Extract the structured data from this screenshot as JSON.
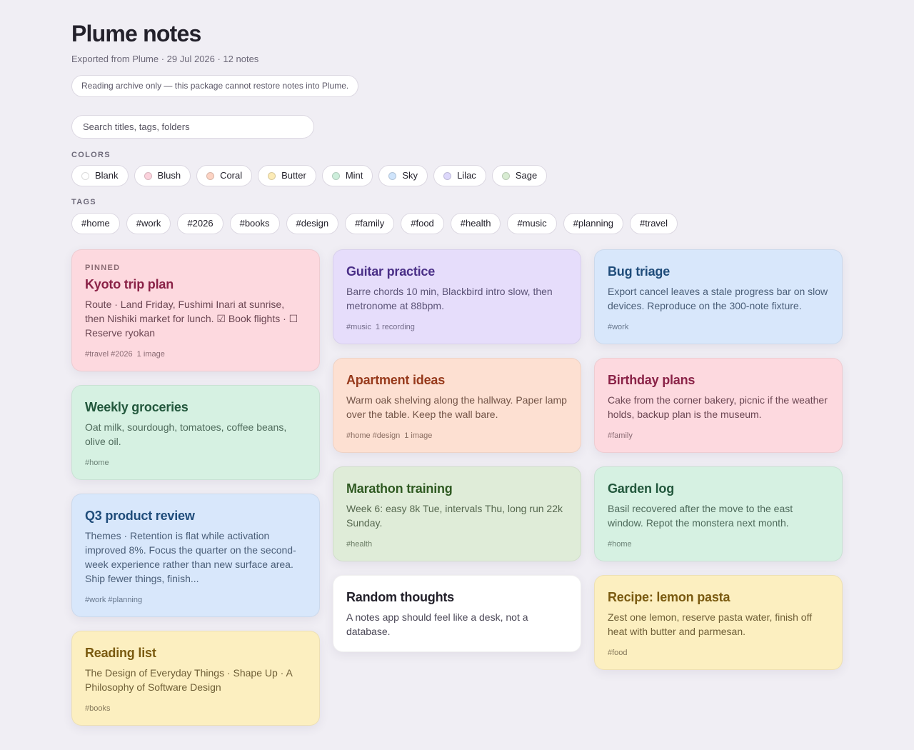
{
  "header": {
    "title": "Plume notes",
    "subtitle": "Exported from Plume · 29 Jul 2026 · 12 notes",
    "notice": "Reading archive only — this package cannot restore notes into Plume."
  },
  "search": {
    "placeholder": "Search titles, tags, folders"
  },
  "colors": {
    "label": "COLORS",
    "items": [
      {
        "label": "Blank",
        "swatch": "#ffffff"
      },
      {
        "label": "Blush",
        "swatch": "#fbd2dc"
      },
      {
        "label": "Coral",
        "swatch": "#fcd3c3"
      },
      {
        "label": "Butter",
        "swatch": "#fcebb6"
      },
      {
        "label": "Mint",
        "swatch": "#cdeedb"
      },
      {
        "label": "Sky",
        "swatch": "#cfe4fb"
      },
      {
        "label": "Lilac",
        "swatch": "#ddd8fb"
      },
      {
        "label": "Sage",
        "swatch": "#d8ecd2"
      }
    ]
  },
  "tags": {
    "label": "TAGS",
    "items": [
      "#home",
      "#work",
      "#2026",
      "#books",
      "#design",
      "#family",
      "#food",
      "#health",
      "#music",
      "#planning",
      "#travel"
    ]
  },
  "notes": [
    {
      "pinned_label": "PINNED",
      "title": "Kyoto trip plan",
      "body": "Route · Land Friday, Fushimi Inari at sunrise, then Nishiki market for lunch. ☑ Book flights · ☐ Reserve ryokan",
      "tags": "#travel #2026",
      "extra": "1 image",
      "bg": "#fdd9df",
      "title_color": "#8a2247",
      "body_color": "#6b4652",
      "meta_color": "#8a6b73"
    },
    {
      "title": "Weekly groceries",
      "body": "Oat milk, sourdough, tomatoes, coffee beans, olive oil.",
      "tags": "#home",
      "bg": "#d6f1e2",
      "title_color": "#22573c",
      "body_color": "#4e6a5b",
      "meta_color": "#6b8276"
    },
    {
      "title": "Q3 product review",
      "body": "Themes · Retention is flat while activation improved 8%. Focus the quarter on the second-week experience rather than new surface area. Ship fewer things, finish...",
      "tags": "#work #planning",
      "bg": "#d8e7fb",
      "title_color": "#1f4c7a",
      "body_color": "#4a5e78",
      "meta_color": "#66768c"
    },
    {
      "title": "Reading list",
      "body": "The Design of Everyday Things · Shape Up · A Philosophy of Software Design",
      "tags": "#books",
      "bg": "#fcefc0",
      "title_color": "#7a5a10",
      "body_color": "#6e5e36",
      "meta_color": "#85785a"
    },
    {
      "title": "Guitar practice",
      "body": "Barre chords 10 min, Blackbird intro slow, then metronome at 88bpm.",
      "tags": "#music",
      "extra": "1 recording",
      "bg": "#e6ddfb",
      "title_color": "#4a2f87",
      "body_color": "#5c5478",
      "meta_color": "#736c8a"
    },
    {
      "title": "Apartment ideas",
      "body": "Warm oak shelving along the hallway. Paper lamp over the table. Keep the wall bare.",
      "tags": "#home #design",
      "extra": "1 image",
      "bg": "#fde0d2",
      "title_color": "#973a1c",
      "body_color": "#735447",
      "meta_color": "#8a6d61"
    },
    {
      "title": "Marathon training",
      "body": "Week 6: easy 8k Tue, intervals Thu, long run 22k Sunday.",
      "tags": "#health",
      "bg": "#dfecd8",
      "title_color": "#2f5a22",
      "body_color": "#56684f",
      "meta_color": "#6c7d66"
    },
    {
      "title": "Random thoughts",
      "body": "A notes app should feel like a desk, not a database.",
      "bg": "#ffffff",
      "title_color": "#23212b",
      "body_color": "#4a4756",
      "meta_color": "#77737f"
    },
    {
      "title": "Bug triage",
      "body": "Export cancel leaves a stale progress bar on slow devices. Reproduce on the 300-note fixture.",
      "tags": "#work",
      "bg": "#d8e7fb",
      "title_color": "#1f4c7a",
      "body_color": "#4a5e78",
      "meta_color": "#66768c"
    },
    {
      "title": "Birthday plans",
      "body": "Cake from the corner bakery, picnic if the weather holds, backup plan is the museum.",
      "tags": "#family",
      "bg": "#fdd9df",
      "title_color": "#8a2247",
      "body_color": "#6b4652",
      "meta_color": "#8a6b73"
    },
    {
      "title": "Garden log",
      "body": "Basil recovered after the move to the east window. Repot the monstera next month.",
      "tags": "#home",
      "bg": "#d6f1e2",
      "title_color": "#22573c",
      "body_color": "#4e6a5b",
      "meta_color": "#6b8276"
    },
    {
      "title": "Recipe: lemon pasta",
      "body": "Zest one lemon, reserve pasta water, finish off heat with butter and parmesan.",
      "tags": "#food",
      "bg": "#fcefc0",
      "title_color": "#7a5a10",
      "body_color": "#6e5e36",
      "meta_color": "#85785a"
    }
  ]
}
